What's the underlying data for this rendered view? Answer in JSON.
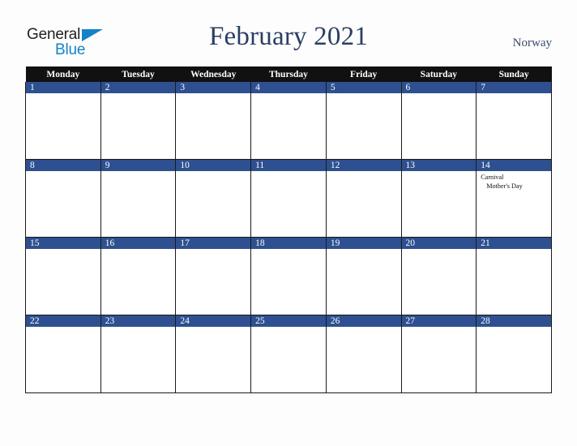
{
  "brand": {
    "name_part1": "General",
    "name_part2": "Blue",
    "triangle_color": "#1482c8",
    "text_color": "#231f20"
  },
  "header": {
    "title": "February 2021",
    "country": "Norway",
    "title_color": "#2b3f63"
  },
  "calendar": {
    "weekdays": [
      "Monday",
      "Tuesday",
      "Wednesday",
      "Thursday",
      "Friday",
      "Saturday",
      "Sunday"
    ],
    "header_bg": "#111111",
    "daynum_bg": "#2e5090",
    "weeks": [
      {
        "days": [
          {
            "num": "1",
            "events": []
          },
          {
            "num": "2",
            "events": []
          },
          {
            "num": "3",
            "events": []
          },
          {
            "num": "4",
            "events": []
          },
          {
            "num": "5",
            "events": []
          },
          {
            "num": "6",
            "events": []
          },
          {
            "num": "7",
            "events": []
          }
        ]
      },
      {
        "days": [
          {
            "num": "8",
            "events": []
          },
          {
            "num": "9",
            "events": []
          },
          {
            "num": "10",
            "events": []
          },
          {
            "num": "11",
            "events": []
          },
          {
            "num": "12",
            "events": []
          },
          {
            "num": "13",
            "events": []
          },
          {
            "num": "14",
            "events": [
              "Carnival",
              "Mother's Day"
            ]
          }
        ]
      },
      {
        "days": [
          {
            "num": "15",
            "events": []
          },
          {
            "num": "16",
            "events": []
          },
          {
            "num": "17",
            "events": []
          },
          {
            "num": "18",
            "events": []
          },
          {
            "num": "19",
            "events": []
          },
          {
            "num": "20",
            "events": []
          },
          {
            "num": "21",
            "events": []
          }
        ]
      },
      {
        "days": [
          {
            "num": "22",
            "events": []
          },
          {
            "num": "23",
            "events": []
          },
          {
            "num": "24",
            "events": []
          },
          {
            "num": "25",
            "events": []
          },
          {
            "num": "26",
            "events": []
          },
          {
            "num": "27",
            "events": []
          },
          {
            "num": "28",
            "events": []
          }
        ]
      }
    ]
  }
}
